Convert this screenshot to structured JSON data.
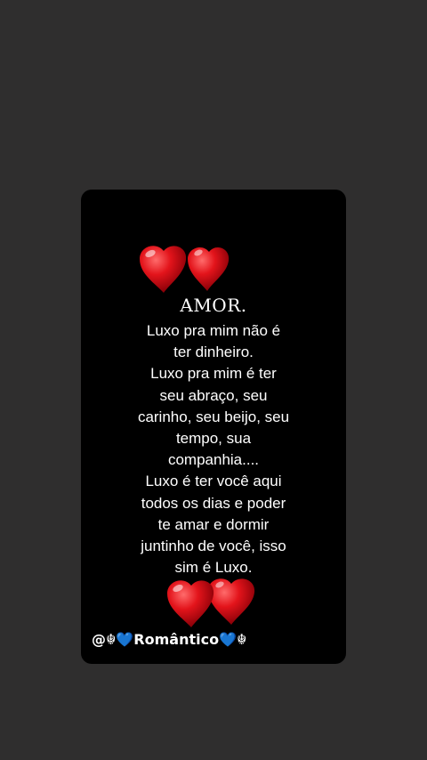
{
  "post": {
    "title": "AMOR.",
    "lines": [
      "Luxo pra mim não é",
      "ter dinheiro.",
      "Luxo pra mim é ter",
      "seu abraço, seu",
      "carinho, seu beijo, seu",
      "tempo, sua",
      "companhia....",
      "Luxo é ter você aqui",
      "todos os dias e poder",
      "te amar e dormir",
      "juntinho de você, isso",
      "sim é Luxo."
    ],
    "handle": "@☬💙Romântico💙☬"
  },
  "icons": {
    "top": "two-hearts-icon",
    "bottom": "two-hearts-icon"
  },
  "colors": {
    "background": "#2f2e2e",
    "card": "#000000",
    "heart": "#e0141b",
    "text": "#ffffff"
  }
}
